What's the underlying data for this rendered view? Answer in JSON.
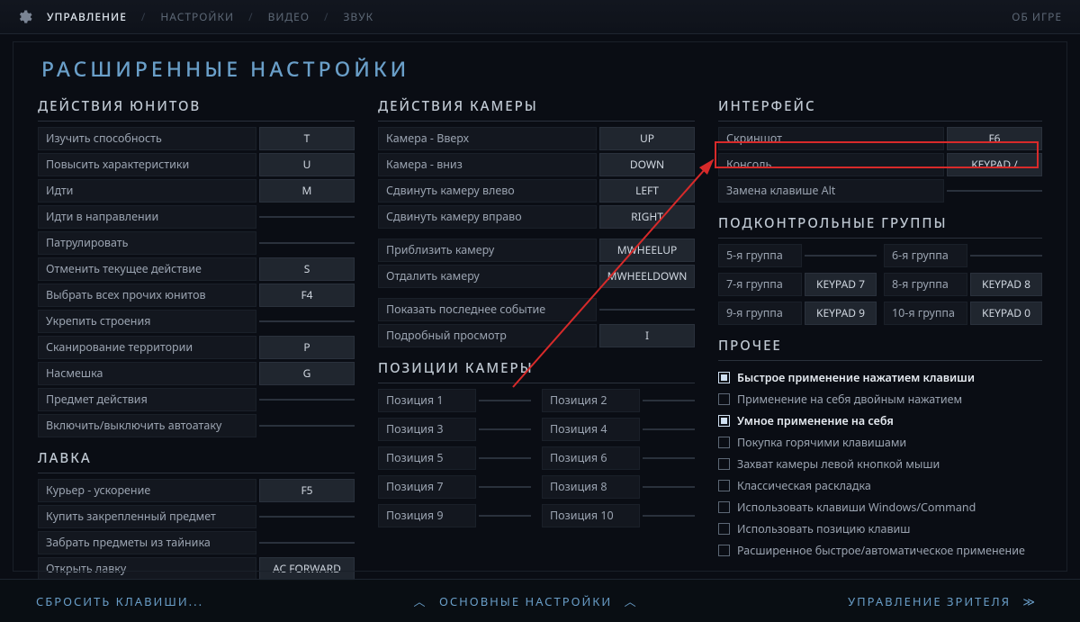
{
  "nav": {
    "tabs": [
      "УПРАВЛЕНИЕ",
      "НАСТРОЙКИ",
      "ВИДЕО",
      "ЗВУК"
    ],
    "active_index": 0,
    "about": "ОБ ИГРЕ"
  },
  "page_title": "РАСШИРЕННЫЕ НАСТРОЙКИ",
  "sections": {
    "unit_actions": {
      "title": "ДЕЙСТВИЯ ЮНИТОВ",
      "rows": [
        {
          "label": "Изучить способность",
          "key": "T"
        },
        {
          "label": "Повысить характеристики",
          "key": "U"
        },
        {
          "label": "Идти",
          "key": "M"
        },
        {
          "label": "Идти в направлении",
          "key": ""
        },
        {
          "label": "Патрулировать",
          "key": ""
        },
        {
          "label": "Отменить текущее действие",
          "key": "S"
        },
        {
          "label": "Выбрать всех прочих юнитов",
          "key": "F4"
        },
        {
          "label": "Укрепить строения",
          "key": ""
        },
        {
          "label": "Сканирование территории",
          "key": "P"
        },
        {
          "label": "Насмешка",
          "key": "G"
        },
        {
          "label": "Предмет действия",
          "key": ""
        },
        {
          "label": "Включить/выключить автоатаку",
          "key": ""
        }
      ]
    },
    "shop": {
      "title": "ЛАВКА",
      "rows": [
        {
          "label": "Курьер - ускорение",
          "key": "F5"
        },
        {
          "label": "Купить закрепленный предмет",
          "key": ""
        },
        {
          "label": "Забрать предметы из тайника",
          "key": ""
        },
        {
          "label": "Открыть лавку",
          "key": "AC FORWARD"
        }
      ]
    },
    "camera_actions": {
      "title": "ДЕЙСТВИЯ КАМЕРЫ",
      "rows": [
        {
          "label": "Камера - Вверх",
          "key": "UP"
        },
        {
          "label": "Камера - вниз",
          "key": "DOWN"
        },
        {
          "label": "Сдвинуть камеру влево",
          "key": "LEFT"
        },
        {
          "label": "Сдвинуть камеру вправо",
          "key": "RIGHT"
        }
      ],
      "rows2": [
        {
          "label": "Приблизить камеру",
          "key": "MWHEELUP"
        },
        {
          "label": "Отдалить камеру",
          "key": "MWHEELDOWN"
        }
      ],
      "rows3": [
        {
          "label": "Показать последнее событие",
          "key": ""
        },
        {
          "label": "Подробный просмотр",
          "key": "I"
        }
      ]
    },
    "camera_positions": {
      "title": "ПОЗИЦИИ КАМЕРЫ",
      "rows": [
        {
          "label": "Позиция 1",
          "key": ""
        },
        {
          "label": "Позиция 2",
          "key": ""
        },
        {
          "label": "Позиция 3",
          "key": ""
        },
        {
          "label": "Позиция 4",
          "key": ""
        },
        {
          "label": "Позиция 5",
          "key": ""
        },
        {
          "label": "Позиция 6",
          "key": ""
        },
        {
          "label": "Позиция 7",
          "key": ""
        },
        {
          "label": "Позиция 8",
          "key": ""
        },
        {
          "label": "Позиция 9",
          "key": ""
        },
        {
          "label": "Позиция 10",
          "key": ""
        }
      ]
    },
    "interface": {
      "title": "ИНТЕРФЕЙС",
      "rows": [
        {
          "label": "Скриншот",
          "key": "F6"
        },
        {
          "label": "Консоль",
          "key": "KEYPAD /"
        },
        {
          "label": "Замена клавише Alt",
          "key": ""
        }
      ]
    },
    "control_groups": {
      "title": "ПОДКОНТРОЛЬНЫЕ ГРУППЫ",
      "rows": [
        {
          "label": "5-я группа",
          "key": ""
        },
        {
          "label": "6-я группа",
          "key": ""
        },
        {
          "label": "7-я группа",
          "key": "KEYPAD 7"
        },
        {
          "label": "8-я группа",
          "key": "KEYPAD 8"
        },
        {
          "label": "9-я группа",
          "key": "KEYPAD 9"
        },
        {
          "label": "10-я группа",
          "key": "KEYPAD 0"
        }
      ]
    },
    "misc": {
      "title": "ПРОЧЕЕ",
      "rows": [
        {
          "label": "Быстрое применение нажатием клавиши",
          "checked": true
        },
        {
          "label": "Применение на себя двойным нажатием",
          "checked": false
        },
        {
          "label": "Умное применение на себя",
          "checked": true
        },
        {
          "label": "Покупка горячими клавишами",
          "checked": false
        },
        {
          "label": "Захват камеры левой кнопкой мыши",
          "checked": false
        },
        {
          "label": "Классическая раскладка",
          "checked": false
        },
        {
          "label": "Использовать клавиши Windows/Command",
          "checked": false
        },
        {
          "label": "Использовать позицию клавиш",
          "checked": false
        },
        {
          "label": "Расширенное быстрое/автоматическое применение",
          "checked": false
        }
      ]
    }
  },
  "bottom": {
    "reset": "CБРОСИТЬ КЛАВИШИ...",
    "basic": "ОСНОВНЫЕ НАСТРОЙКИ",
    "spectator": "УПРАВЛЕНИЕ ЗРИТЕЛЯ"
  },
  "highlight_row_index": 1
}
